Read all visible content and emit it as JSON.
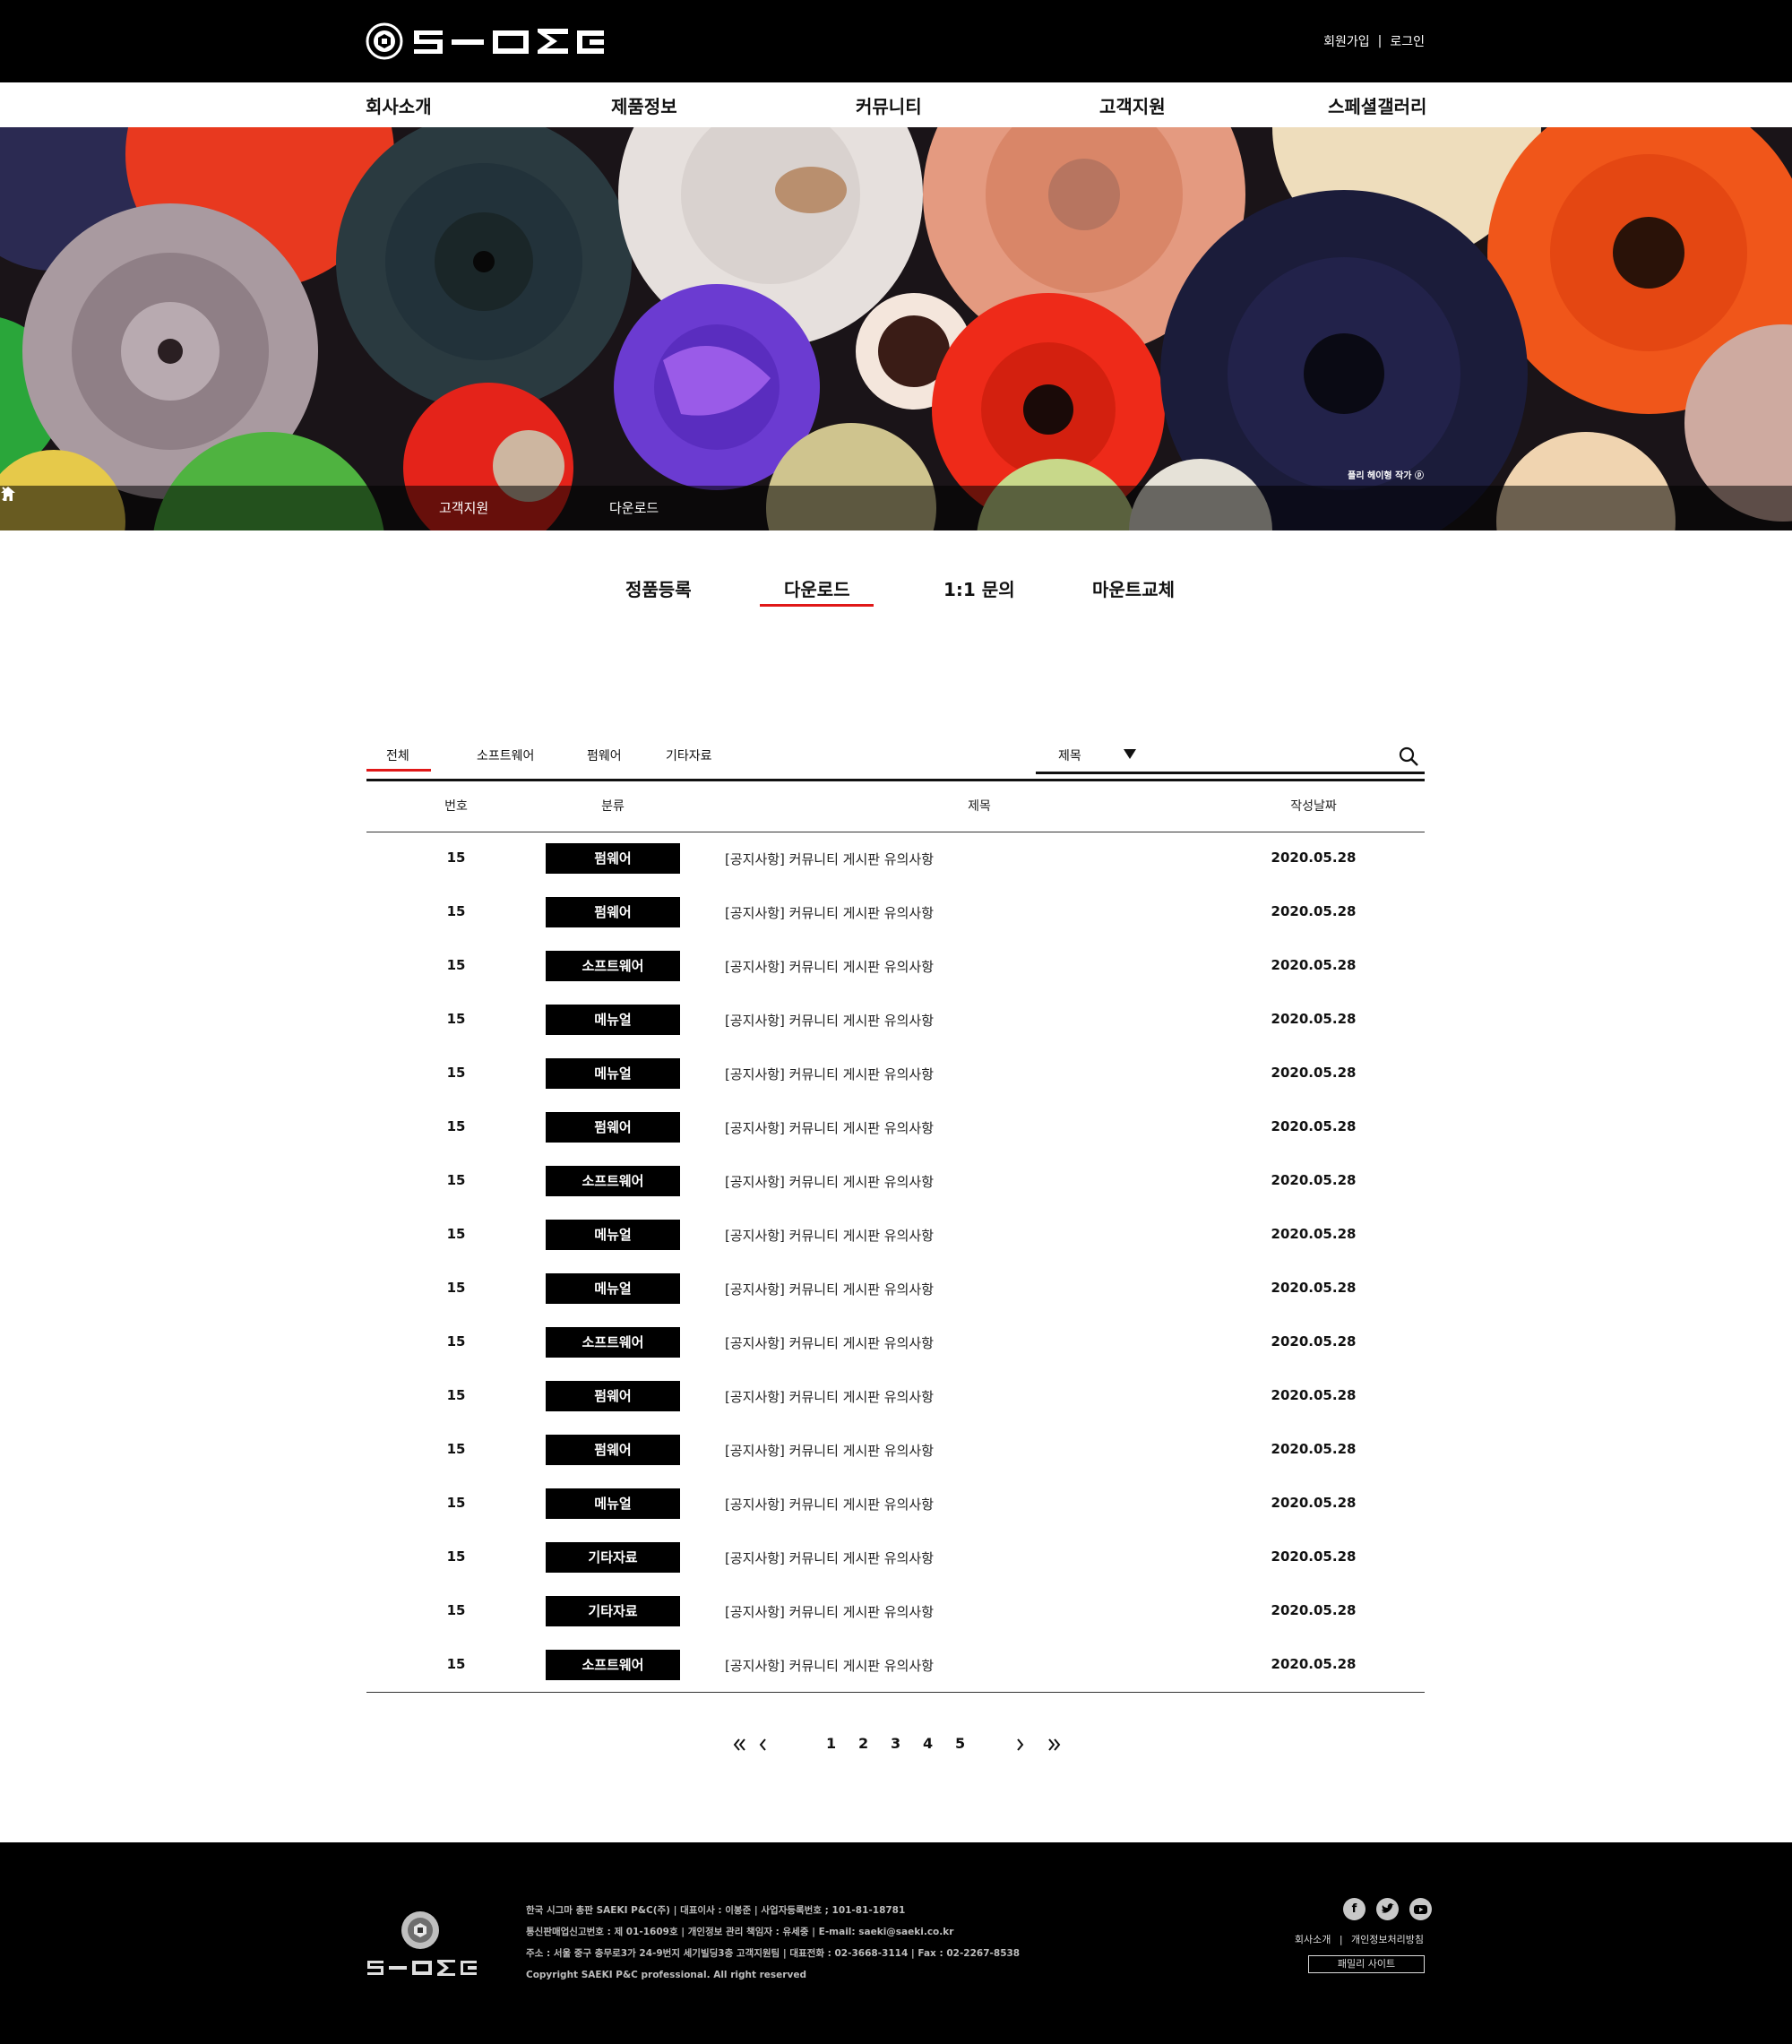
{
  "header": {
    "auth_links": [
      "회원가입",
      "로그인"
    ],
    "separator": "|"
  },
  "gnb": [
    "회사소개",
    "제품정보",
    "커뮤니티",
    "고객지원",
    "스페셜갤러리"
  ],
  "banner": {
    "breadcrumb": [
      "고객지원",
      "다운로드"
    ],
    "credit": "플리 헤이형 작가 ⓟ"
  },
  "subtabs": {
    "items": [
      "정품등록",
      "다운로드",
      "1:1 문의",
      "마운트교체"
    ],
    "active": "다운로드"
  },
  "board": {
    "categories": [
      "전체",
      "소프트웨어",
      "펌웨어",
      "기타자료"
    ],
    "active_category": "전체",
    "search": {
      "field": "제목",
      "value": ""
    },
    "columns": [
      "번호",
      "분류",
      "제목",
      "작성날짜"
    ],
    "rows": [
      {
        "num": "15",
        "category": "펌웨어",
        "title": "[공지사항] 커뮤니티 게시판 유의사항",
        "date": "2020.05.28"
      },
      {
        "num": "15",
        "category": "펌웨어",
        "title": "[공지사항] 커뮤니티 게시판 유의사항",
        "date": "2020.05.28"
      },
      {
        "num": "15",
        "category": "소프트웨어",
        "title": "[공지사항] 커뮤니티 게시판 유의사항",
        "date": "2020.05.28"
      },
      {
        "num": "15",
        "category": "메뉴얼",
        "title": "[공지사항] 커뮤니티 게시판 유의사항",
        "date": "2020.05.28"
      },
      {
        "num": "15",
        "category": "메뉴얼",
        "title": "[공지사항] 커뮤니티 게시판 유의사항",
        "date": "2020.05.28"
      },
      {
        "num": "15",
        "category": "펌웨어",
        "title": "[공지사항] 커뮤니티 게시판 유의사항",
        "date": "2020.05.28"
      },
      {
        "num": "15",
        "category": "소프트웨어",
        "title": "[공지사항] 커뮤니티 게시판 유의사항",
        "date": "2020.05.28"
      },
      {
        "num": "15",
        "category": "메뉴얼",
        "title": "[공지사항] 커뮤니티 게시판 유의사항",
        "date": "2020.05.28"
      },
      {
        "num": "15",
        "category": "메뉴얼",
        "title": "[공지사항] 커뮤니티 게시판 유의사항",
        "date": "2020.05.28"
      },
      {
        "num": "15",
        "category": "소프트웨어",
        "title": "[공지사항] 커뮤니티 게시판 유의사항",
        "date": "2020.05.28"
      },
      {
        "num": "15",
        "category": "펌웨어",
        "title": "[공지사항] 커뮤니티 게시판 유의사항",
        "date": "2020.05.28"
      },
      {
        "num": "15",
        "category": "펌웨어",
        "title": "[공지사항] 커뮤니티 게시판 유의사항",
        "date": "2020.05.28"
      },
      {
        "num": "15",
        "category": "메뉴얼",
        "title": "[공지사항] 커뮤니티 게시판 유의사항",
        "date": "2020.05.28"
      },
      {
        "num": "15",
        "category": "기타자료",
        "title": "[공지사항] 커뮤니티 게시판 유의사항",
        "date": "2020.05.28"
      },
      {
        "num": "15",
        "category": "기타자료",
        "title": "[공지사항] 커뮤니티 게시판 유의사항",
        "date": "2020.05.28"
      },
      {
        "num": "15",
        "category": "소프트웨어",
        "title": "[공지사항] 커뮤니티 게시판 유의사항",
        "date": "2020.05.28"
      }
    ]
  },
  "pagination": {
    "first": "«",
    "prev": "‹",
    "pages": [
      "1",
      "2",
      "3",
      "4",
      "5"
    ],
    "next": "›",
    "last": "»"
  },
  "footer": {
    "info_lines": [
      "한국 시그마 총판 SAEKI P&C(주) | 대표이사 : 이봉준 | 사업자등록번호 ; 101-81-18781",
      "통신판매업신고번호 : 제 01-1609호 | 개인정보 관리 책임자 : 유세중 | E-mail: saeki@saeki.co.kr",
      "주소 : 서울 중구 충무로3가 24-9번지 세기빌딩3층 고객지원팀 | 대표전화 : 02-3668-3114 | Fax : 02-2267-8538",
      "Copyright SAEKI P&C professional. All right reserved"
    ],
    "social": [
      "facebook-icon",
      "twitter-icon",
      "youtube-icon"
    ],
    "links": [
      "회사소개",
      "개인정보처리방침"
    ],
    "family_site": "패밀리 사이트"
  },
  "colors": {
    "accent": "#e01818",
    "header_bg": "#000000",
    "badge_bg": "#000000"
  }
}
